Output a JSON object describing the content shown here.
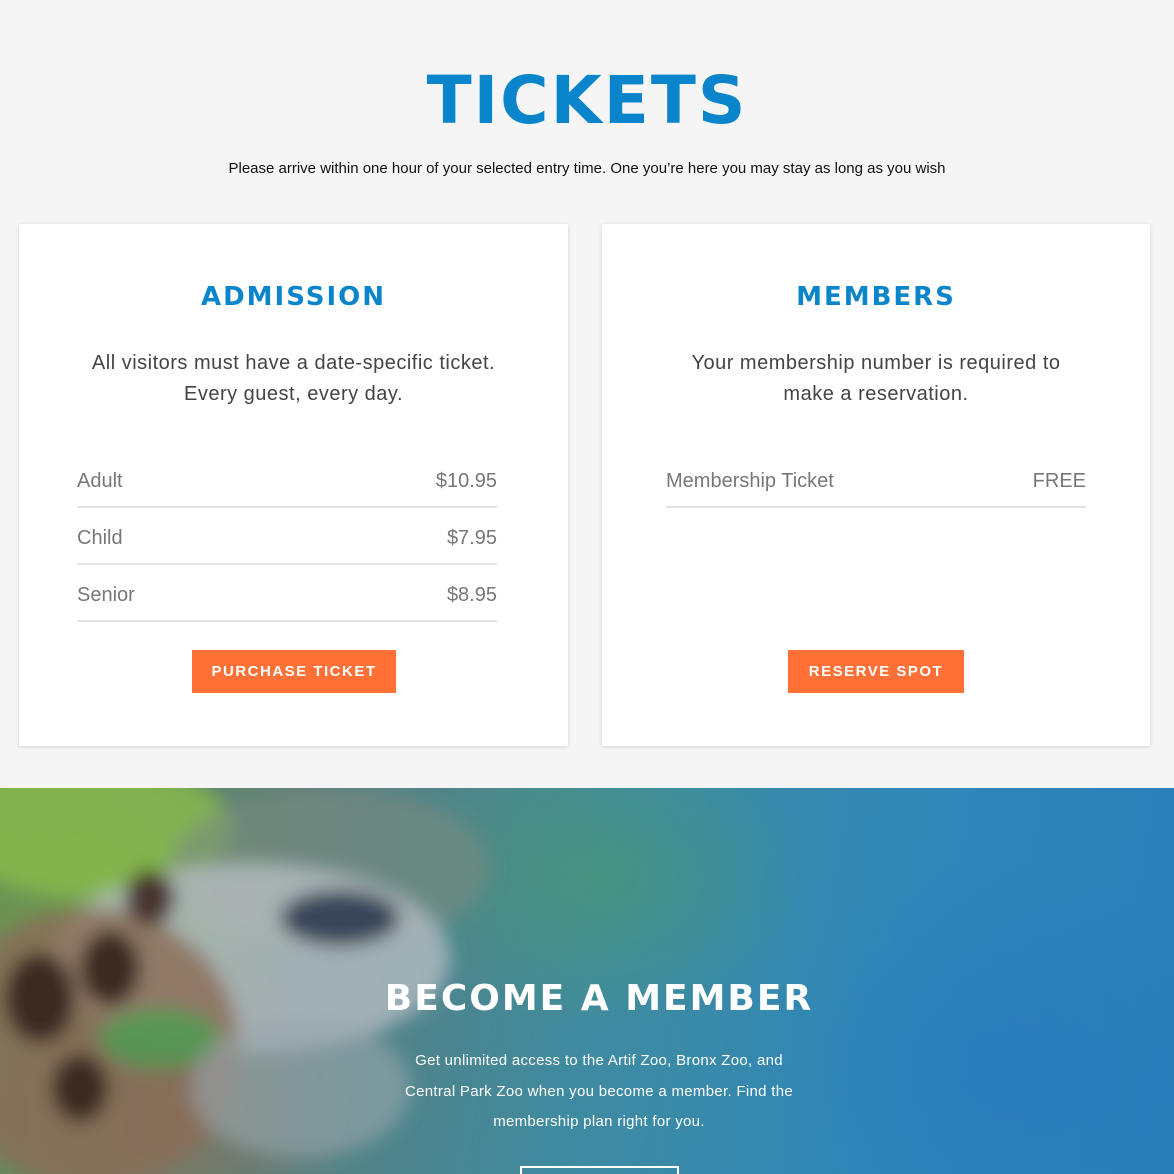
{
  "tickets": {
    "title": "TICKETS",
    "subtitle": "Please arrive within one hour of your selected entry time. One you’re here you may stay as long as you wish"
  },
  "admission": {
    "title": "ADMISSION",
    "description": "All visitors must have a date-specific ticket. Every guest, every day.",
    "prices": [
      {
        "label": "Adult",
        "price": "$10.95"
      },
      {
        "label": "Child",
        "price": "$7.95"
      },
      {
        "label": "Senior",
        "price": "$8.95"
      }
    ],
    "button_label": "PURCHASE TICKET"
  },
  "members": {
    "title": "MEMBERS",
    "description": "Your membership number is required to make a reservation.",
    "prices": [
      {
        "label": "Membership Ticket",
        "price": "FREE"
      }
    ],
    "button_label": "RESERVE SPOT"
  },
  "become_member": {
    "title": "BECOME A MEMBER",
    "text": "Get unlimited access to the Artif Zoo, Bronx Zoo, and Central Park Zoo when you become a member. Find the membership plan right for you."
  },
  "colors": {
    "accent_blue": "#0a85cc",
    "button_orange": "#fe7036",
    "background": "#f5f5f5"
  }
}
